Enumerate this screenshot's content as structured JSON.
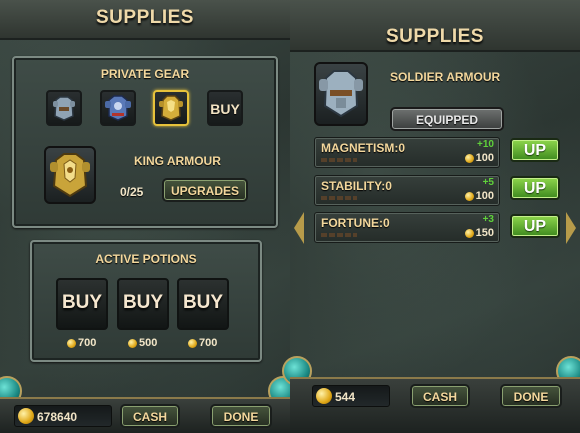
{
  "left_screen": {
    "title": "SUPPLIES",
    "private_gear": {
      "heading": "PRIVATE GEAR",
      "slots": [
        {
          "icon": "steel-armour-icon",
          "selected": false
        },
        {
          "icon": "blue-armour-icon",
          "selected": false
        },
        {
          "icon": "gold-armour-icon",
          "selected": true
        },
        {
          "label": "BUY"
        }
      ],
      "selected_name": "KING ARMOUR",
      "progress": "0/25",
      "upgrades_label": "UPGRADES"
    },
    "active_potions": {
      "heading": "ACTIVE POTIONS",
      "slots": [
        {
          "label": "BUY",
          "cost": "700"
        },
        {
          "label": "BUY",
          "cost": "500"
        },
        {
          "label": "BUY",
          "cost": "700"
        }
      ]
    },
    "bottom": {
      "cash_value": "678640",
      "cash_label": "CASH",
      "done_label": "DONE"
    }
  },
  "right_screen": {
    "title": "SUPPLIES",
    "armour_name": "SOLDIER ARMOUR",
    "equipped_label": "EQUIPPED",
    "stats": [
      {
        "label": "MAGNETISM:0",
        "bonus": "+10",
        "cost": "100",
        "button": "UP"
      },
      {
        "label": "STABILITY:0",
        "bonus": "+5",
        "cost": "100",
        "button": "UP"
      },
      {
        "label": "FORTUNE:0",
        "bonus": "+3",
        "cost": "150",
        "button": "UP"
      }
    ],
    "bottom": {
      "cash_value": "544",
      "cash_label": "CASH",
      "done_label": "DONE"
    }
  },
  "colors": {
    "gold_text": "#f3d79c",
    "green_button": "#5cb830",
    "selected_border": "#e7c23b"
  }
}
